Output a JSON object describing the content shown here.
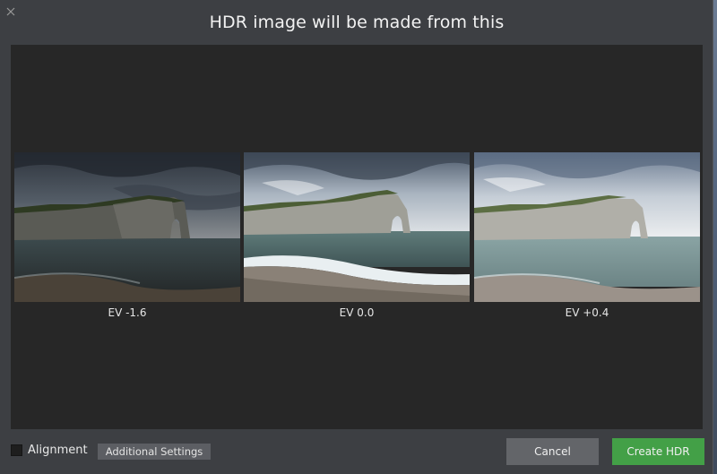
{
  "dialog": {
    "title": "HDR image will be made from this",
    "close_icon": "close-icon"
  },
  "images": [
    {
      "label": "EV -1.6",
      "exposure": "dark"
    },
    {
      "label": "EV 0.0",
      "exposure": "normal"
    },
    {
      "label": "EV +0.4",
      "exposure": "bright"
    }
  ],
  "footer": {
    "alignment_label": "Alignment",
    "alignment_checked": false,
    "settings_label": "Additional Settings",
    "cancel_label": "Cancel",
    "create_label": "Create HDR"
  },
  "colors": {
    "dialog_bg": "#3d3f43",
    "preview_bg": "#272727",
    "primary_button": "#43a047",
    "secondary_button": "#636569"
  }
}
